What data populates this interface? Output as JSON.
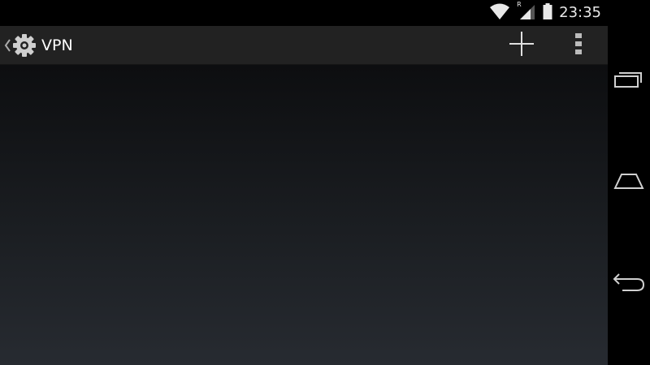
{
  "status_bar": {
    "time": "23:35",
    "roaming_indicator": "R",
    "icons": [
      "wifi-icon",
      "signal-icon",
      "battery-icon"
    ]
  },
  "action_bar": {
    "title": "VPN",
    "icons": [
      "up-caret-icon",
      "settings-gear-icon",
      "plus-icon",
      "overflow-menu-icon"
    ]
  },
  "nav_bar": {
    "icons": [
      "recents-icon",
      "home-icon",
      "back-icon"
    ]
  },
  "colors": {
    "action_bar_bg": "#222222",
    "status_bar_bg": "#000000",
    "content_top": "#0d0e10",
    "content_bottom": "#272b31",
    "icon_color": "#dddddd"
  }
}
